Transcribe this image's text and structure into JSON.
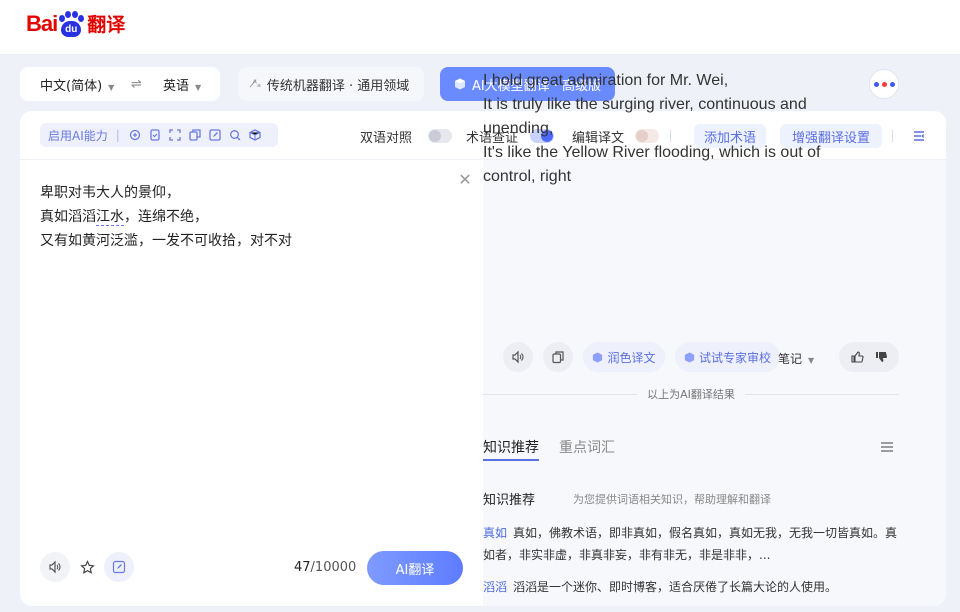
{
  "header": {
    "logo_bai": "Bai",
    "logo_du": "du",
    "logo_fanyi": "翻译"
  },
  "lang": {
    "source": "中文(简体)",
    "swap": "⇌",
    "target": "英语"
  },
  "modes": {
    "traditional": "传统机器翻译 · 通用领域",
    "ai": "AI大模型翻译 · 高级版"
  },
  "toolbar": {
    "ai_capability": "启用AI能力",
    "bilingual": "双语对照",
    "term_check": "术语查证",
    "edit_translation": "编辑译文",
    "add_term": "添加术语",
    "enhance_settings": "增强翻译设置"
  },
  "source": {
    "line1": "卑职对韦大人的景仰，",
    "line2_pre": "真如滔滔",
    "line2_ul": "江水",
    "line2_post": "，连绵不绝，",
    "line3": "又有如黄河泛滥，一发不可收拾，对不对"
  },
  "counter": {
    "current": "47",
    "max": "/10000"
  },
  "ai_translate_button": "AI翻译",
  "target": {
    "lines": [
      "I hold great admiration for Mr. Wei,",
      "It is truly like the surging river, continuous and",
      "unending,",
      "It's like the Yellow River flooding, which is out of",
      "control, right"
    ]
  },
  "actions": {
    "polish": "润色译文",
    "expert_review": "试试专家审校",
    "notes": "笔记"
  },
  "result_note": "以上为AI翻译结果",
  "tabs": {
    "knowledge": "知识推荐",
    "vocab": "重点词汇"
  },
  "knowledge": {
    "title": "知识推荐",
    "subtitle": "为您提供词语相关知识，帮助理解和翻译",
    "entries": [
      {
        "term": "真如",
        "text": "真如，佛教术语，即非真如，假名真如，真如无我，无我一切皆真如。真如者，非实非虚，非真非妄，非有非无，非是非非，..."
      },
      {
        "term": "滔滔",
        "text": "滔滔是一个迷你、即时博客，适合厌倦了长篇大论的人使用。"
      }
    ]
  },
  "colors": {
    "accent": "#5a6fe0",
    "brand_red": "#e10602",
    "brand_blue": "#2932e1",
    "ai_button": "#6a8bff"
  }
}
